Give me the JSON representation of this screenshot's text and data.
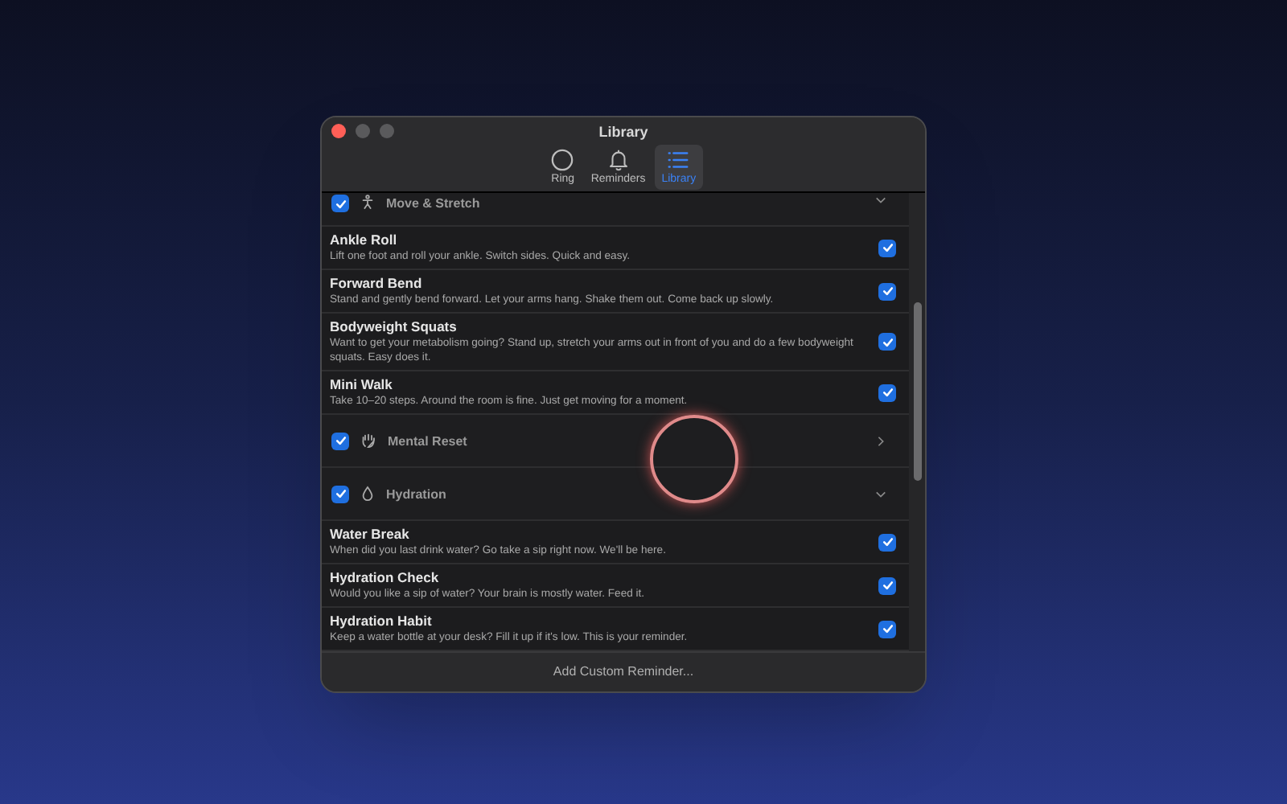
{
  "window": {
    "title": "Library"
  },
  "tabs": [
    {
      "label": "Ring",
      "selected": false
    },
    {
      "label": "Reminders",
      "selected": false
    },
    {
      "label": "Library",
      "selected": true
    }
  ],
  "groups": [
    {
      "title": "Move & Stretch",
      "checked": true,
      "expanded": true,
      "items": [
        {
          "title": "Ankle Roll",
          "description": "Lift one foot and roll your ankle. Switch sides. Quick and easy.",
          "checked": true
        },
        {
          "title": "Forward Bend",
          "description": "Stand and gently bend forward. Let your arms hang. Shake them out. Come back up slowly.",
          "checked": true
        },
        {
          "title": "Bodyweight Squats",
          "description": "Want to get your metabolism going? Stand up, stretch your arms out in front of you and do a few bodyweight squats. Easy does it.",
          "checked": true
        },
        {
          "title": "Mini Walk",
          "description": "Take 10–20 steps. Around the room is fine. Just get moving for a moment.",
          "checked": true
        }
      ]
    },
    {
      "title": "Mental Reset",
      "checked": true,
      "expanded": false
    },
    {
      "title": "Hydration",
      "checked": true,
      "expanded": true,
      "items": [
        {
          "title": "Water Break",
          "description": "When did you last drink water? Go take a sip right now. We'll be here.",
          "checked": true
        },
        {
          "title": "Hydration Check",
          "description": "Would you like a sip of water? Your brain is mostly water. Feed it.",
          "checked": true
        },
        {
          "title": "Hydration Habit",
          "description": "Keep a water bottle at your desk? Fill it up if it's low. This is your reminder.",
          "checked": true
        }
      ]
    }
  ],
  "footer_button": "Add Custom Reminder..."
}
